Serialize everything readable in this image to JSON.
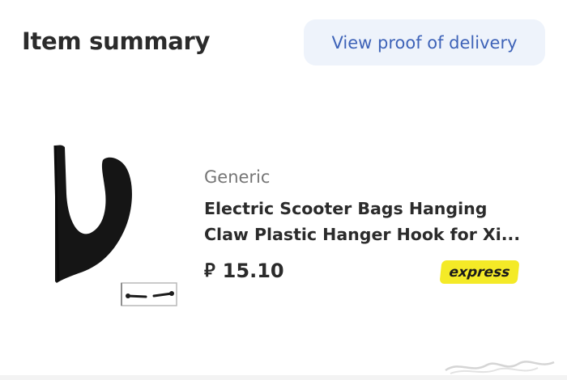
{
  "header": {
    "title": "Item summary",
    "proof_button_label": "View proof of delivery"
  },
  "item": {
    "brand": "Generic",
    "name": "Electric Scooter Bags Hanging Claw Plastic Hanger Hook for Xi...",
    "currency_symbol": "⃁",
    "price": "15.10",
    "badge_label": "express",
    "image_icon": "scooter-hook-product-image"
  },
  "colors": {
    "accent_text": "#3e63b8",
    "button_bg": "#eef3fb",
    "express_yellow": "#f4ea27",
    "text_primary": "#2b2b2b",
    "text_secondary": "#757575"
  }
}
